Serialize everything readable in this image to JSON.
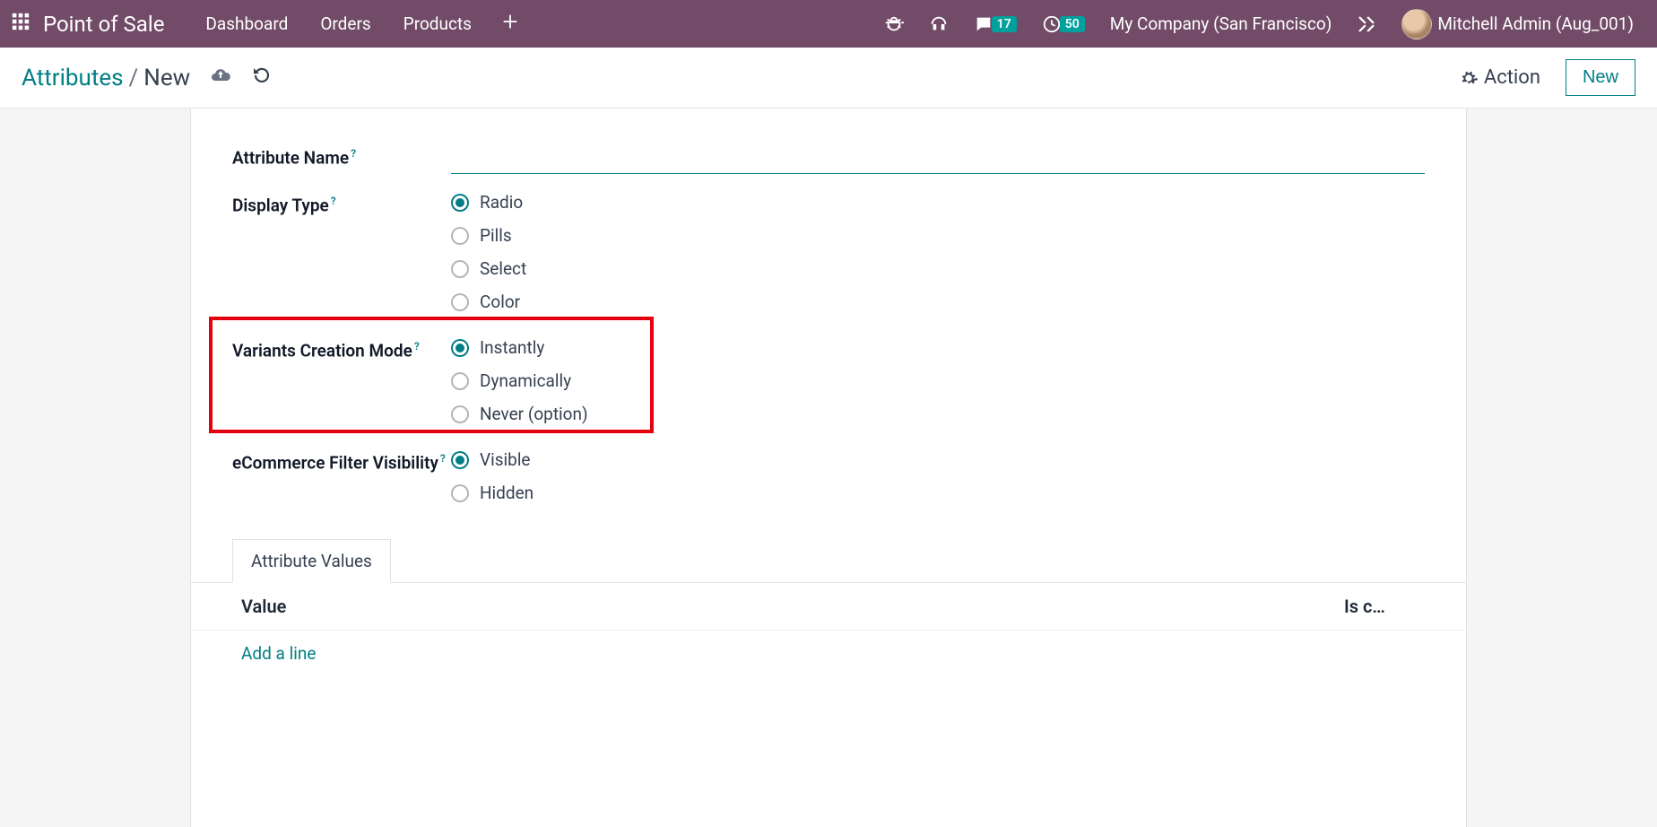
{
  "topbar": {
    "brand": "Point of Sale",
    "nav": [
      "Dashboard",
      "Orders",
      "Products"
    ],
    "msg_badge": "17",
    "activity_badge": "50",
    "company": "My Company (San Francisco)",
    "user": "Mitchell Admin (Aug_001)"
  },
  "breadcrumb": {
    "parent": "Attributes",
    "current": "New",
    "action_label": "Action",
    "new_label": "New"
  },
  "form": {
    "attr_name": {
      "label": "Attribute Name",
      "value": ""
    },
    "display_type": {
      "label": "Display Type",
      "options": [
        "Radio",
        "Pills",
        "Select",
        "Color"
      ],
      "selected": "Radio"
    },
    "variants_mode": {
      "label": "Variants Creation Mode",
      "options": [
        "Instantly",
        "Dynamically",
        "Never (option)"
      ],
      "selected": "Instantly"
    },
    "ecom_vis": {
      "label": "eCommerce Filter Visibility",
      "options": [
        "Visible",
        "Hidden"
      ],
      "selected": "Visible"
    }
  },
  "tab": {
    "label": "Attribute Values"
  },
  "table": {
    "col_value": "Value",
    "col_is": "Is c…",
    "add_line": "Add a line"
  }
}
